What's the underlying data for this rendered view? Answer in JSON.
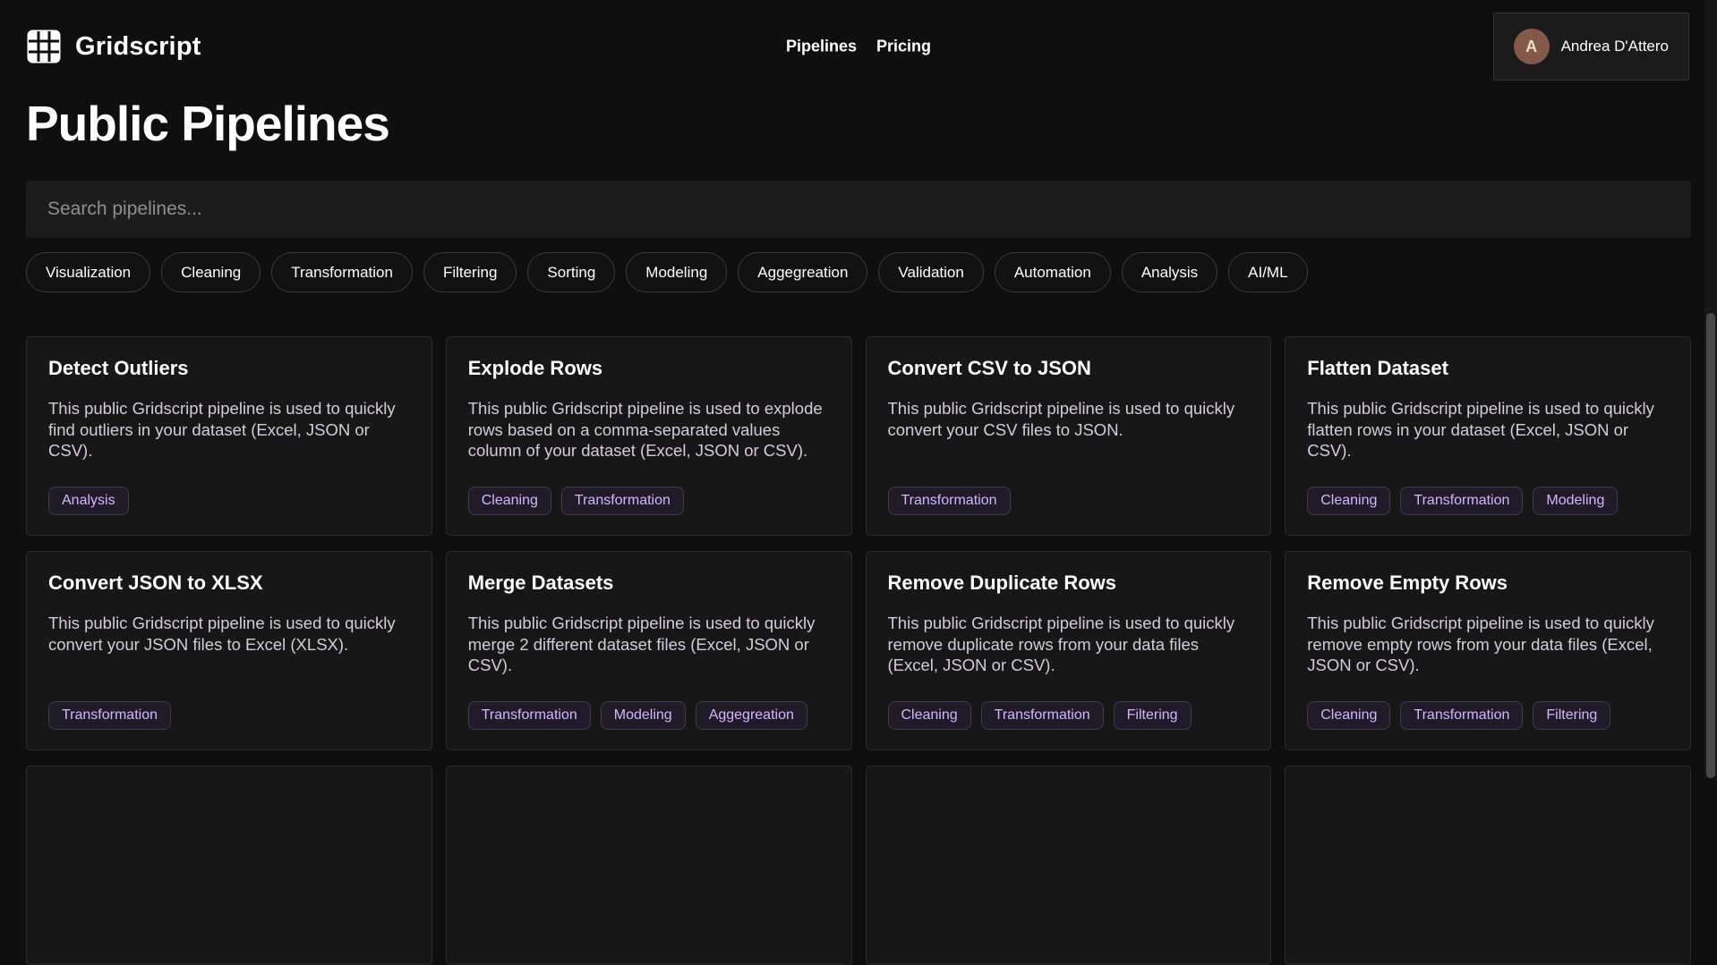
{
  "brand": {
    "name": "Gridscript"
  },
  "nav": {
    "items": [
      {
        "label": "Pipelines"
      },
      {
        "label": "Pricing"
      }
    ]
  },
  "user": {
    "initial": "A",
    "name": "Andrea D'Attero"
  },
  "page": {
    "title": "Public Pipelines"
  },
  "search": {
    "placeholder": "Search pipelines..."
  },
  "filters": [
    "Visualization",
    "Cleaning",
    "Transformation",
    "Filtering",
    "Sorting",
    "Modeling",
    "Aggegreation",
    "Validation",
    "Automation",
    "Analysis",
    "AI/ML"
  ],
  "pipelines": [
    {
      "title": "Detect Outliers",
      "description": "This public Gridscript pipeline is used to quickly find outliers in your dataset (Excel, JSON or CSV).",
      "tags": [
        "Analysis"
      ]
    },
    {
      "title": "Explode Rows",
      "description": "This public Gridscript pipeline is used to explode rows based on a comma-separated values column of your dataset (Excel, JSON or CSV).",
      "tags": [
        "Cleaning",
        "Transformation"
      ]
    },
    {
      "title": "Convert CSV to JSON",
      "description": "This public Gridscript pipeline is used to quickly convert your CSV files to JSON.",
      "tags": [
        "Transformation"
      ]
    },
    {
      "title": "Flatten Dataset",
      "description": "This public Gridscript pipeline is used to quickly flatten rows in your dataset (Excel, JSON or CSV).",
      "tags": [
        "Cleaning",
        "Transformation",
        "Modeling"
      ]
    },
    {
      "title": "Convert JSON to XLSX",
      "description": "This public Gridscript pipeline is used to quickly convert your JSON files to Excel (XLSX).",
      "tags": [
        "Transformation"
      ]
    },
    {
      "title": "Merge Datasets",
      "description": "This public Gridscript pipeline is used to quickly merge 2 different dataset files (Excel, JSON or CSV).",
      "tags": [
        "Transformation",
        "Modeling",
        "Aggegreation"
      ]
    },
    {
      "title": "Remove Duplicate Rows",
      "description": "This public Gridscript pipeline is used to quickly remove duplicate rows from your data files (Excel, JSON or CSV).",
      "tags": [
        "Cleaning",
        "Transformation",
        "Filtering"
      ]
    },
    {
      "title": "Remove Empty Rows",
      "description": "This public Gridscript pipeline is used to quickly remove empty rows from your data files (Excel, JSON or CSV).",
      "tags": [
        "Cleaning",
        "Transformation",
        "Filtering"
      ]
    }
  ],
  "partial_cards_count": 4,
  "colors": {
    "background": "#0f0f0f",
    "card_background": "#171717",
    "tag_accent": "#d8b4fe",
    "avatar_background": "#84594a"
  }
}
